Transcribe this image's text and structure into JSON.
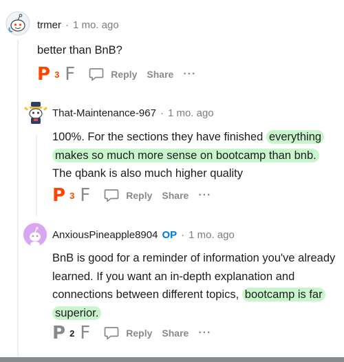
{
  "comments": [
    {
      "username": "trmer",
      "separator": "·",
      "time": "1 mo. ago",
      "op_badge": "",
      "body_plain": "better than BnB?",
      "actions": {
        "up": "P",
        "score": "3",
        "down": "F",
        "reply": "Reply",
        "share": "Share",
        "more": "···"
      },
      "colors": {
        "up": "#ff4500",
        "score": "#ff4500"
      }
    },
    {
      "username": "That-Maintenance-967",
      "separator": "·",
      "time": "1 mo. ago",
      "op_badge": "",
      "body_parts": [
        "100%. For the sections they have finished ",
        "everything makes so much more sense on bootcamp than bnb.",
        " The qbank is also much higher quality"
      ],
      "actions": {
        "up": "P",
        "score": "3",
        "down": "F",
        "reply": "Reply",
        "share": "Share",
        "more": "···"
      },
      "colors": {
        "up": "#ff4500",
        "score": "#ff4500"
      }
    },
    {
      "username": "AnxiousPineapple8904",
      "separator": "·",
      "time": "1 mo. ago",
      "op_badge": "OP",
      "body_parts": [
        "BnB is good for a reminder of information you've already learned. If you want an in-depth explanation and connections between different topics,",
        "bootcamp is far superior."
      ],
      "actions": {
        "up": "P",
        "score": "2",
        "down": "F",
        "reply": "Reply",
        "share": "Share",
        "more": "···"
      },
      "colors": {
        "up": "#878a8c",
        "score": "#1c1c1c"
      }
    }
  ],
  "highlight_color": "#c8f5cc",
  "icons": {
    "comment": "comment-bubble-icon",
    "avatar1": "snoo-avatar",
    "avatar2": "snoo-avatar-hat",
    "avatar3": "snoo-avatar-purple"
  }
}
